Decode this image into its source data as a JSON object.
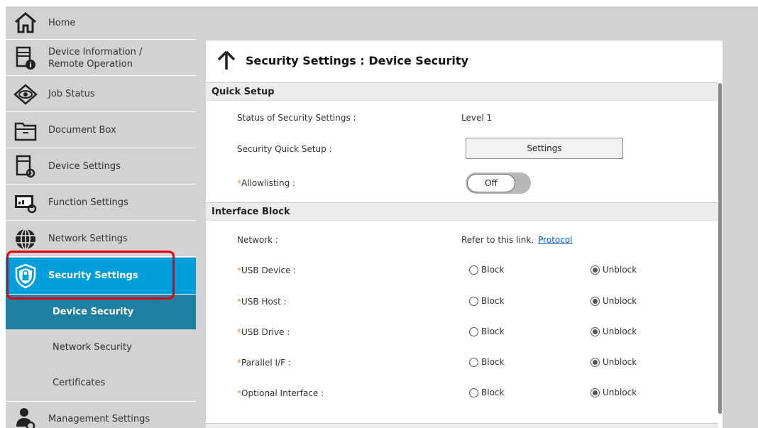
{
  "sidebar": {
    "items": [
      {
        "label": "Home",
        "icon": "home-icon"
      },
      {
        "label": "Device Information /",
        "label2": "Remote Operation",
        "icon": "device-info-icon"
      },
      {
        "label": "Job Status",
        "icon": "eye-icon"
      },
      {
        "label": "Document Box",
        "icon": "document-box-icon"
      },
      {
        "label": "Device Settings",
        "icon": "device-settings-icon"
      },
      {
        "label": "Function Settings",
        "icon": "function-settings-icon"
      },
      {
        "label": "Network Settings",
        "icon": "globe-icon"
      },
      {
        "label": "Security Settings",
        "icon": "shield-lock-icon"
      },
      {
        "label": "Management Settings",
        "icon": "user-gear-icon"
      }
    ],
    "sub_items": [
      {
        "label": "Device Security"
      },
      {
        "label": "Network Security"
      },
      {
        "label": "Certificates"
      }
    ]
  },
  "page": {
    "title": "Security Settings : Device Security"
  },
  "quick_setup": {
    "header": "Quick Setup",
    "status_label": "Status of Security Settings :",
    "status_value": "Level 1",
    "quick_setup_label": "Security Quick Setup :",
    "settings_button": "Settings",
    "allowlisting_label": "Allowlisting :",
    "allowlisting_value": "Off"
  },
  "interface_block": {
    "header": "Interface Block",
    "network_label": "Network :",
    "network_text": "Refer to this link.",
    "network_link": "Protocol",
    "block_label": "Block",
    "unblock_label": "Unblock",
    "rows": [
      {
        "label": "USB Device :",
        "selected": "Unblock"
      },
      {
        "label": "USB Host :",
        "selected": "Unblock"
      },
      {
        "label": "USB Drive :",
        "selected": "Unblock"
      },
      {
        "label": "Parallel I/F :",
        "selected": "Unblock"
      },
      {
        "label": "Optional Interface :",
        "selected": "Unblock"
      }
    ]
  },
  "colors": {
    "accent": "#009fdb",
    "accent_dark": "#1f7fa0",
    "highlight": "#e3000f",
    "required": "#f08a2e"
  }
}
